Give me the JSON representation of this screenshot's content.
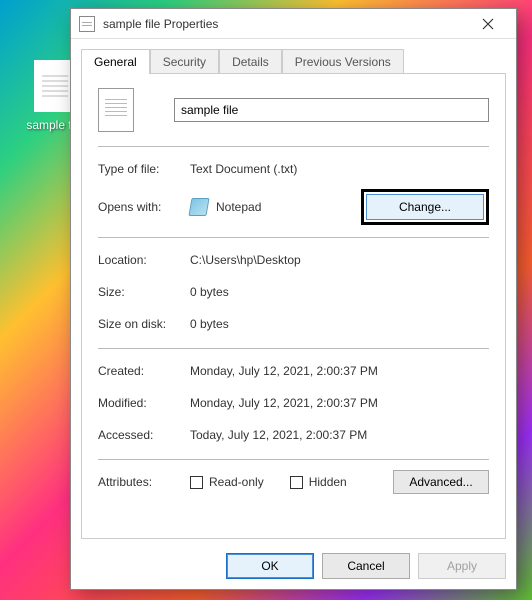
{
  "desktop": {
    "icon_label": "sample file"
  },
  "dialog": {
    "title": "sample file Properties",
    "tabs": [
      "General",
      "Security",
      "Details",
      "Previous Versions"
    ],
    "active_tab": 0,
    "general": {
      "filename": "sample file",
      "labels": {
        "type": "Type of file:",
        "opens_with": "Opens with:",
        "location": "Location:",
        "size": "Size:",
        "size_on_disk": "Size on disk:",
        "created": "Created:",
        "modified": "Modified:",
        "accessed": "Accessed:",
        "attributes": "Attributes:"
      },
      "values": {
        "type": "Text Document (.txt)",
        "opens_with": "Notepad",
        "location": "C:\\Users\\hp\\Desktop",
        "size": "0 bytes",
        "size_on_disk": "0 bytes",
        "created": "Monday, July 12, 2021, 2:00:37 PM",
        "modified": "Monday, July 12, 2021, 2:00:37 PM",
        "accessed": "Today, July 12, 2021, 2:00:37 PM"
      },
      "checkboxes": {
        "readonly": "Read-only",
        "hidden": "Hidden"
      },
      "buttons": {
        "change": "Change...",
        "advanced": "Advanced..."
      }
    },
    "footer": {
      "ok": "OK",
      "cancel": "Cancel",
      "apply": "Apply"
    }
  }
}
